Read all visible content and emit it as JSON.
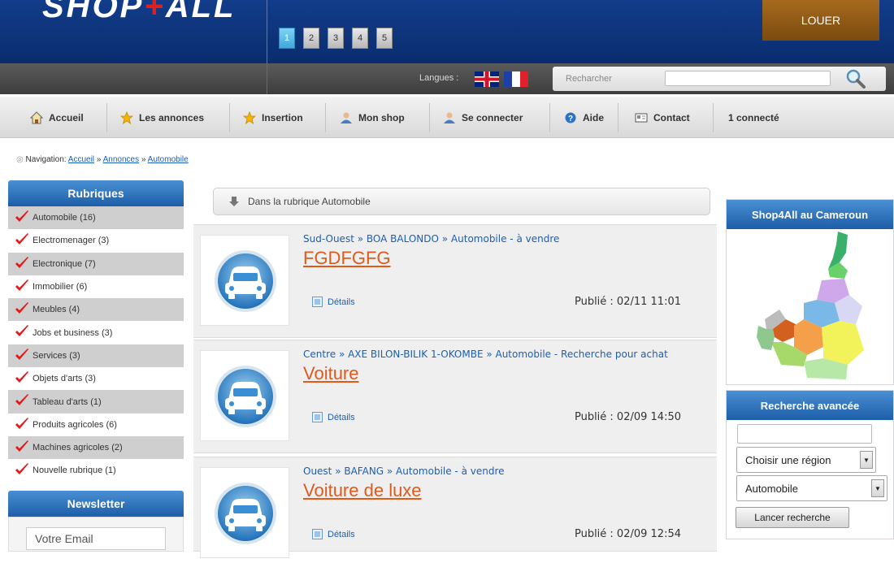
{
  "header": {
    "logo_main": "SHOP",
    "logo_plus": "+",
    "logo_end": "ALL",
    "pages": [
      "1",
      "2",
      "3",
      "4",
      "5"
    ],
    "active_page": "1",
    "louer": "LOUER"
  },
  "subbar": {
    "langues": "Langues :",
    "search_label": "Recharcher"
  },
  "nav": {
    "items": [
      {
        "label": "Accueil",
        "icon": "home-icon"
      },
      {
        "label": "Les annonces",
        "icon": "star-icon"
      },
      {
        "label": "Insertion",
        "icon": "star-icon"
      },
      {
        "label": "Mon shop",
        "icon": "user-icon"
      },
      {
        "label": "Se connecter",
        "icon": "user-icon"
      },
      {
        "label": "Aide",
        "icon": "help-icon"
      },
      {
        "label": "Contact",
        "icon": "contact-card-icon"
      }
    ],
    "connected": "1 connecté"
  },
  "breadcrumb": {
    "prefix": "Navigation:",
    "links": [
      "Accueil",
      "Annonces",
      "Automobile"
    ],
    "sep": "»"
  },
  "sidebar": {
    "rubriques_title": "Rubriques",
    "items": [
      {
        "label": "Automobile (16)"
      },
      {
        "label": "Electromenager (3)"
      },
      {
        "label": "Electronique (7)"
      },
      {
        "label": "Immobilier (6)"
      },
      {
        "label": "Meubles (4)"
      },
      {
        "label": "Jobs et business (3)"
      },
      {
        "label": "Services (3)"
      },
      {
        "label": "Objets d'arts (3)"
      },
      {
        "label": "Tableau d'arts (1)"
      },
      {
        "label": "Produits agricoles (6)"
      },
      {
        "label": "Machines agricoles (2)"
      },
      {
        "label": "Nouvelle rubrique (1)"
      }
    ],
    "newsletter_title": "Newsletter",
    "email_placeholder": "Votre Email"
  },
  "main": {
    "banner": "Dans la rubrique Automobile",
    "annonces": [
      {
        "path": "Sud-Ouest » BOA BALONDO » Automobile - à vendre",
        "title": "FGDFGFG",
        "details": "Détails",
        "publie": "Publié : 02/11 11:01"
      },
      {
        "path": "Centre » AXE BILON-BILIK 1-OKOMBE » Automobile - Recherche pour achat",
        "title": "Voiture",
        "details": "Détails",
        "publie": "Publié : 02/09 14:50"
      },
      {
        "path": "Ouest » BAFANG » Automobile - à vendre",
        "title": "Voiture de luxe",
        "details": "Détails",
        "publie": "Publié : 02/09 12:54"
      }
    ]
  },
  "right": {
    "map_title": "Shop4All au Cameroun",
    "adv_title": "Recherche avancée",
    "region_select": "Choisir une région",
    "category_select": "Automobile",
    "launch": "Lancer recherche"
  },
  "colors": {
    "header_blue": "#0a2c6e",
    "louer_brown": "#8a5514",
    "link_blue": "#1a5fb4",
    "title_orange": "#e05a1a",
    "box_header_blue": "#2a6cb8"
  }
}
